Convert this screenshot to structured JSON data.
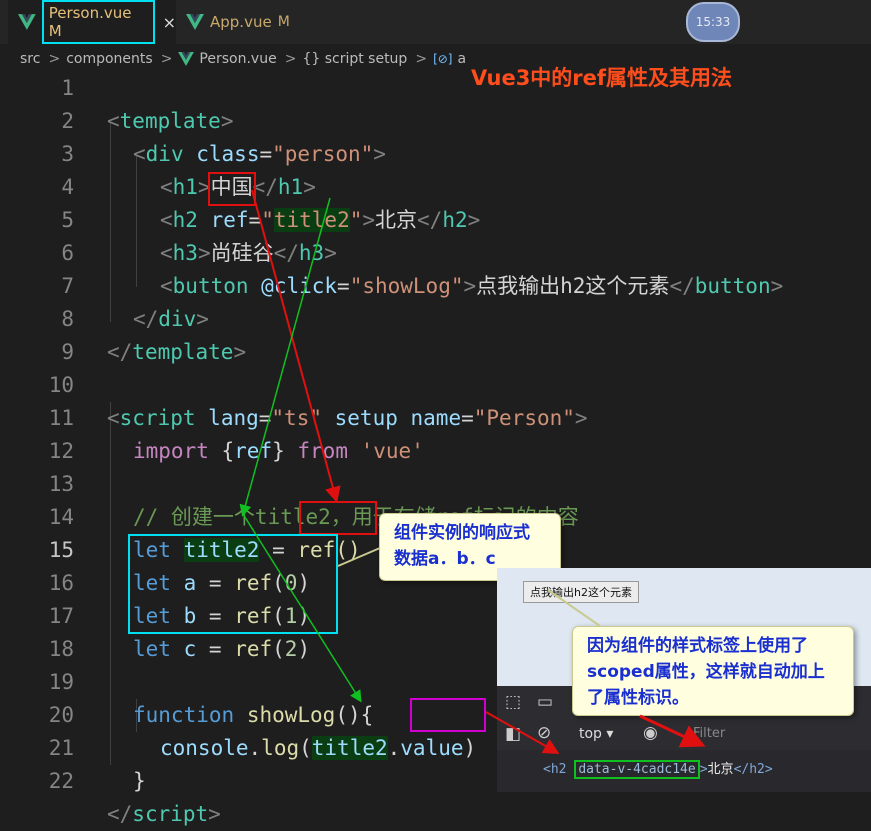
{
  "tabs": [
    {
      "label": "Person.vue",
      "modified": "M",
      "close": "×"
    },
    {
      "label": "App.vue",
      "modified": "M"
    }
  ],
  "clock": "15:33",
  "breadcrumb": {
    "items": [
      "src",
      "components",
      "Person.vue",
      "{} script setup",
      "a"
    ],
    "separator": ">"
  },
  "headline": "Vue3中的ref属性及其用法",
  "code_lines": [
    {
      "n": "1"
    },
    {
      "n": "2"
    },
    {
      "n": "3"
    },
    {
      "n": "4"
    },
    {
      "n": "5"
    },
    {
      "n": "6"
    },
    {
      "n": "7"
    },
    {
      "n": "8"
    },
    {
      "n": "9"
    },
    {
      "n": "10"
    },
    {
      "n": "11"
    },
    {
      "n": "12"
    },
    {
      "n": "13"
    },
    {
      "n": "14"
    },
    {
      "n": "15"
    },
    {
      "n": "16"
    },
    {
      "n": "17"
    },
    {
      "n": "18"
    },
    {
      "n": "19"
    },
    {
      "n": "20"
    },
    {
      "n": "21"
    },
    {
      "n": "22"
    }
  ],
  "code": {
    "l1": [
      "<",
      "template",
      ">"
    ],
    "l2": [
      "<",
      "div",
      " ",
      "class",
      "=",
      "\"person\"",
      ">"
    ],
    "l3": [
      "<",
      "h1",
      ">",
      "中国",
      "</",
      "h1",
      ">"
    ],
    "l4": [
      "<",
      "h2",
      " ",
      "ref",
      "=",
      "\"",
      "title2",
      "\"",
      ">",
      "北京",
      "</",
      "h2",
      ">"
    ],
    "l5": [
      "<",
      "h3",
      ">",
      "尚硅谷",
      "</",
      "h3",
      ">"
    ],
    "l6": [
      "<",
      "button",
      " ",
      "@click",
      "=",
      "\"showLog\"",
      ">",
      "点我输出h2这个元素",
      "</",
      "button",
      ">"
    ],
    "l7": [
      "</",
      "div",
      ">"
    ],
    "l8": [
      "</",
      "template",
      ">"
    ],
    "l10": [
      "<",
      "script",
      " ",
      "lang",
      "=",
      "\"ts\"",
      " ",
      "setup",
      " ",
      "name",
      "=",
      "\"Person\"",
      ">"
    ],
    "l11": [
      "import",
      " {",
      "ref",
      "} ",
      "from",
      " ",
      "'vue'"
    ],
    "l13": [
      "// 创建一个title2，用于存储ref标记的内容"
    ],
    "l14": [
      "let",
      " ",
      "title2",
      " = ",
      "ref()"
    ],
    "l15": [
      "let",
      " ",
      "a",
      " = ",
      "ref",
      "(",
      "0",
      ")"
    ],
    "l16": [
      "let",
      " ",
      "b",
      " = ",
      "ref",
      "(",
      "1",
      ")"
    ],
    "l17": [
      "let",
      " ",
      "c",
      " = ",
      "ref",
      "(",
      "2",
      ")"
    ],
    "l19": [
      "function",
      " ",
      "showLog",
      "(){"
    ],
    "l20": [
      "console",
      ".",
      "log",
      "(",
      "title2",
      ".",
      "value",
      ")"
    ],
    "l21": [
      "}"
    ],
    "l22": [
      "</",
      "script",
      ">"
    ]
  },
  "callouts": {
    "reactive": "组件实例的响应式数据a．b．c",
    "scoped": "因为组件的样式标签上使用了scoped属性，这样就自动加上了属性标识。"
  },
  "browser": {
    "button": "点我输出h2这个元素",
    "context": "top",
    "filter": "Filter",
    "output": {
      "open": "<h2 ",
      "attr": "data-v-4cadc14e",
      "mid": ">",
      "text": "北京",
      "close": "</h2>"
    }
  },
  "colors": {
    "red_box": "#e01010",
    "green_box": "#10c020",
    "magenta_box": "#d000d0",
    "cyan_box": "#00e0f0",
    "headline": "#ff4d1c"
  }
}
